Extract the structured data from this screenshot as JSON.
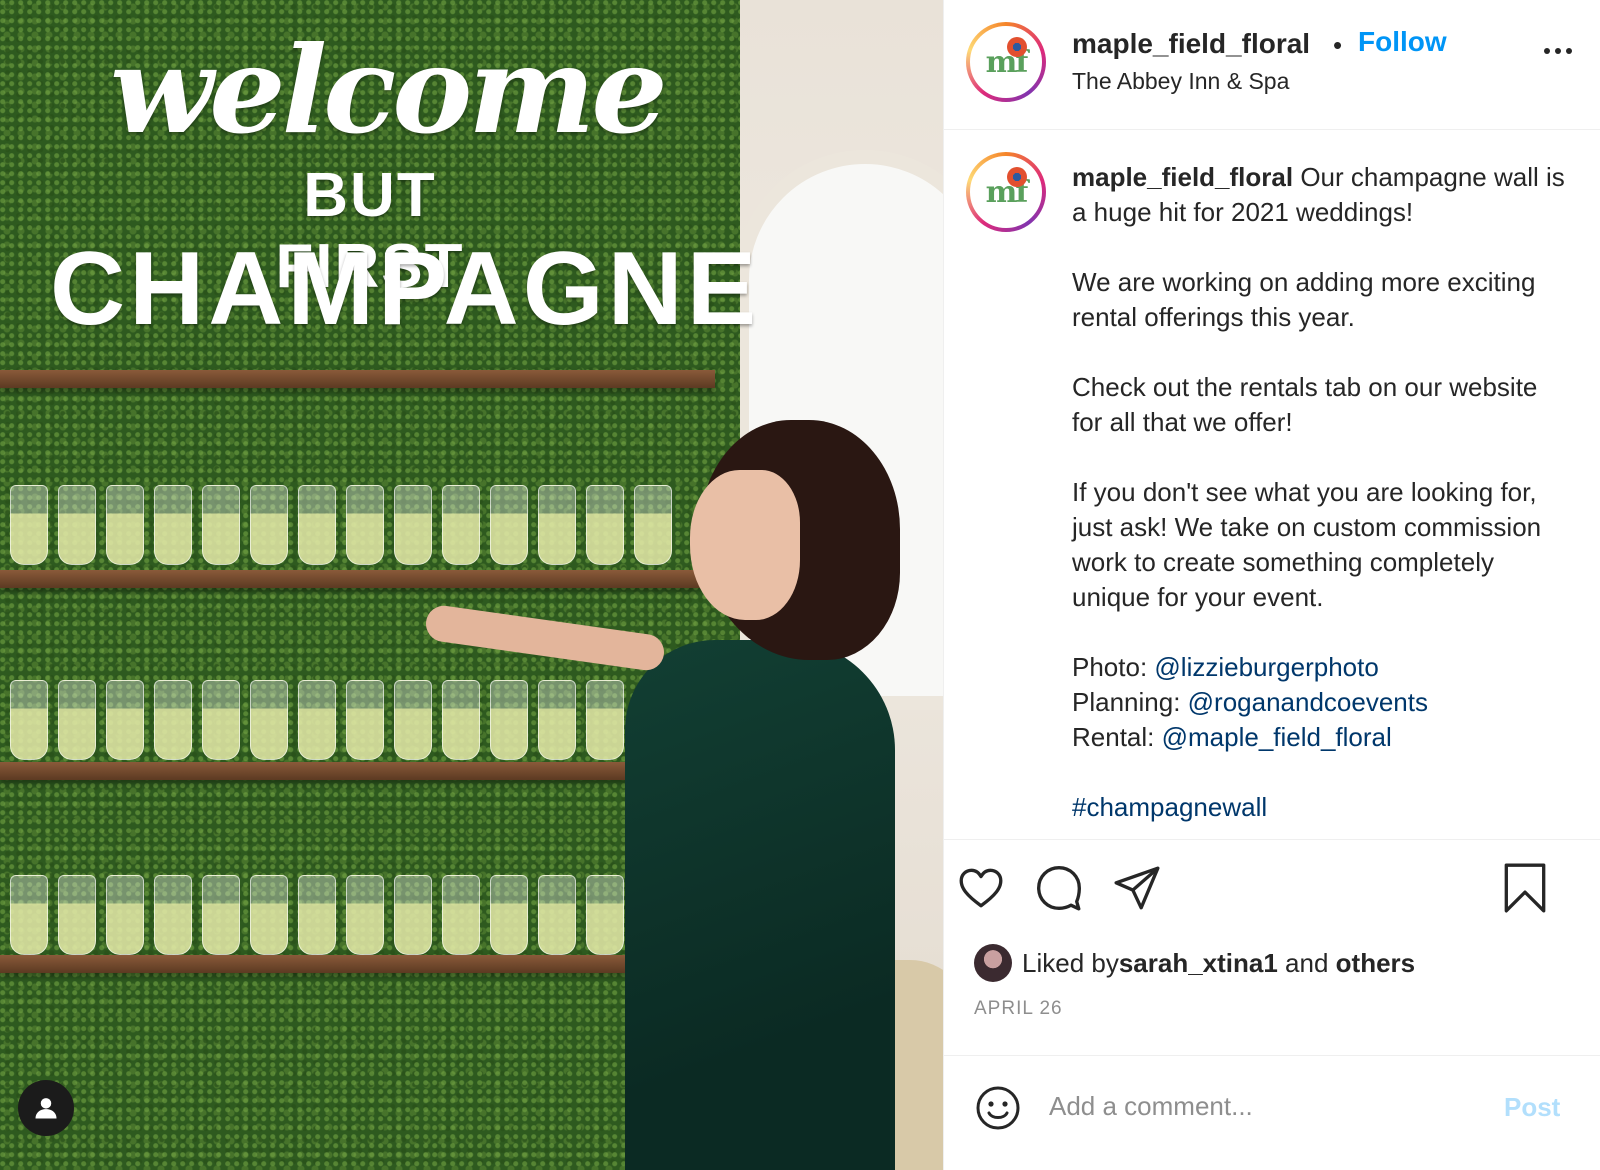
{
  "photo": {
    "sign": {
      "line1": "welcome",
      "line2": "BUT FIRST",
      "line3": "CHAMPAGNE"
    },
    "user_tag_icon": "person-icon"
  },
  "header": {
    "username": "maple_field_floral",
    "separator": "•",
    "follow_label": "Follow",
    "location": "The Abbey Inn & Spa",
    "more_icon": "more-options-icon"
  },
  "caption": {
    "username": "maple_field_floral",
    "para1": "Our champagne wall is a huge hit for 2021 weddings!",
    "para2": "We are working on adding more exciting rental offerings this year.",
    "para3": "Check out the rentals tab on our website for all that we offer!",
    "para4": "If you don't see what you are looking for, just ask! We take on custom commission work to create something completely unique for your event.",
    "credits": [
      {
        "label": "Photo: ",
        "handle": "@lizzieburgerphoto"
      },
      {
        "label": "Planning: ",
        "handle": "@roganandcoevents"
      },
      {
        "label": "Rental: ",
        "handle": "@maple_field_floral"
      }
    ],
    "hashtag": "#champagnewall"
  },
  "actions": {
    "like_icon": "heart-icon",
    "comment_icon": "comment-icon",
    "share_icon": "share-icon",
    "save_icon": "bookmark-icon"
  },
  "likes": {
    "prefix": "Liked by ",
    "user": "sarah_xtina1",
    "middle": " and ",
    "others": "others"
  },
  "date": "APRIL 26",
  "comment": {
    "placeholder": "Add a comment...",
    "post_label": "Post",
    "emoji_icon": "emoji-icon"
  },
  "colors": {
    "follow_blue": "#0095f6",
    "link_navy": "#00376b",
    "post_disabled": "#b2dffc",
    "muted_gray": "#8e8e8e"
  }
}
